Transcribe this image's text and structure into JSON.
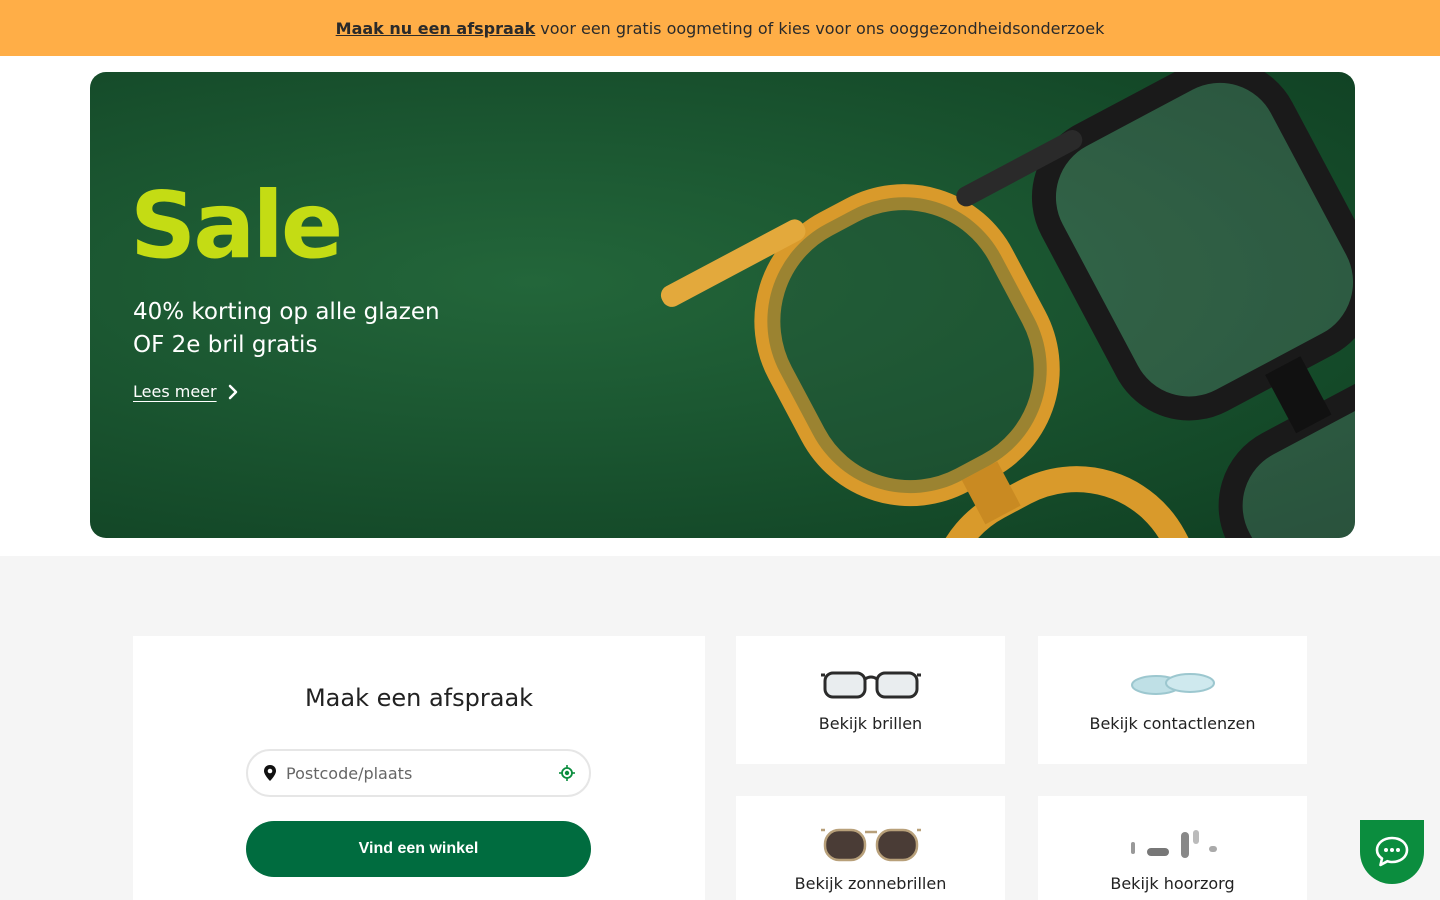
{
  "announcement": {
    "link_text": "Maak nu een afspraak",
    "text": "voor een gratis oogmeting of kies voor ons ooggezondheidsonderzoek"
  },
  "hero": {
    "title": "Sale",
    "line1": "40% korting op alle glazen",
    "line2": "OF 2e bril gratis",
    "link_text": "Lees meer",
    "colors": {
      "title": "#c4dc14",
      "bg": "#1a5530"
    }
  },
  "appointment": {
    "title": "Maak een afspraak",
    "search_placeholder": "Postcode/plaats",
    "button_label": "Vind een winkel",
    "button_color": "#006c3f"
  },
  "tiles": [
    {
      "label": "Bekijk brillen",
      "icon": "glasses-icon"
    },
    {
      "label": "Bekijk contactlenzen",
      "icon": "contact-lens-icon"
    },
    {
      "label": "Bekijk zonnebrillen",
      "icon": "sunglasses-icon"
    },
    {
      "label": "Bekijk hoorzorg",
      "icon": "hearing-aid-icon"
    }
  ],
  "chat": {
    "icon": "chat-icon",
    "color": "#0b8d3e"
  },
  "topbar_color": "#ffae47"
}
